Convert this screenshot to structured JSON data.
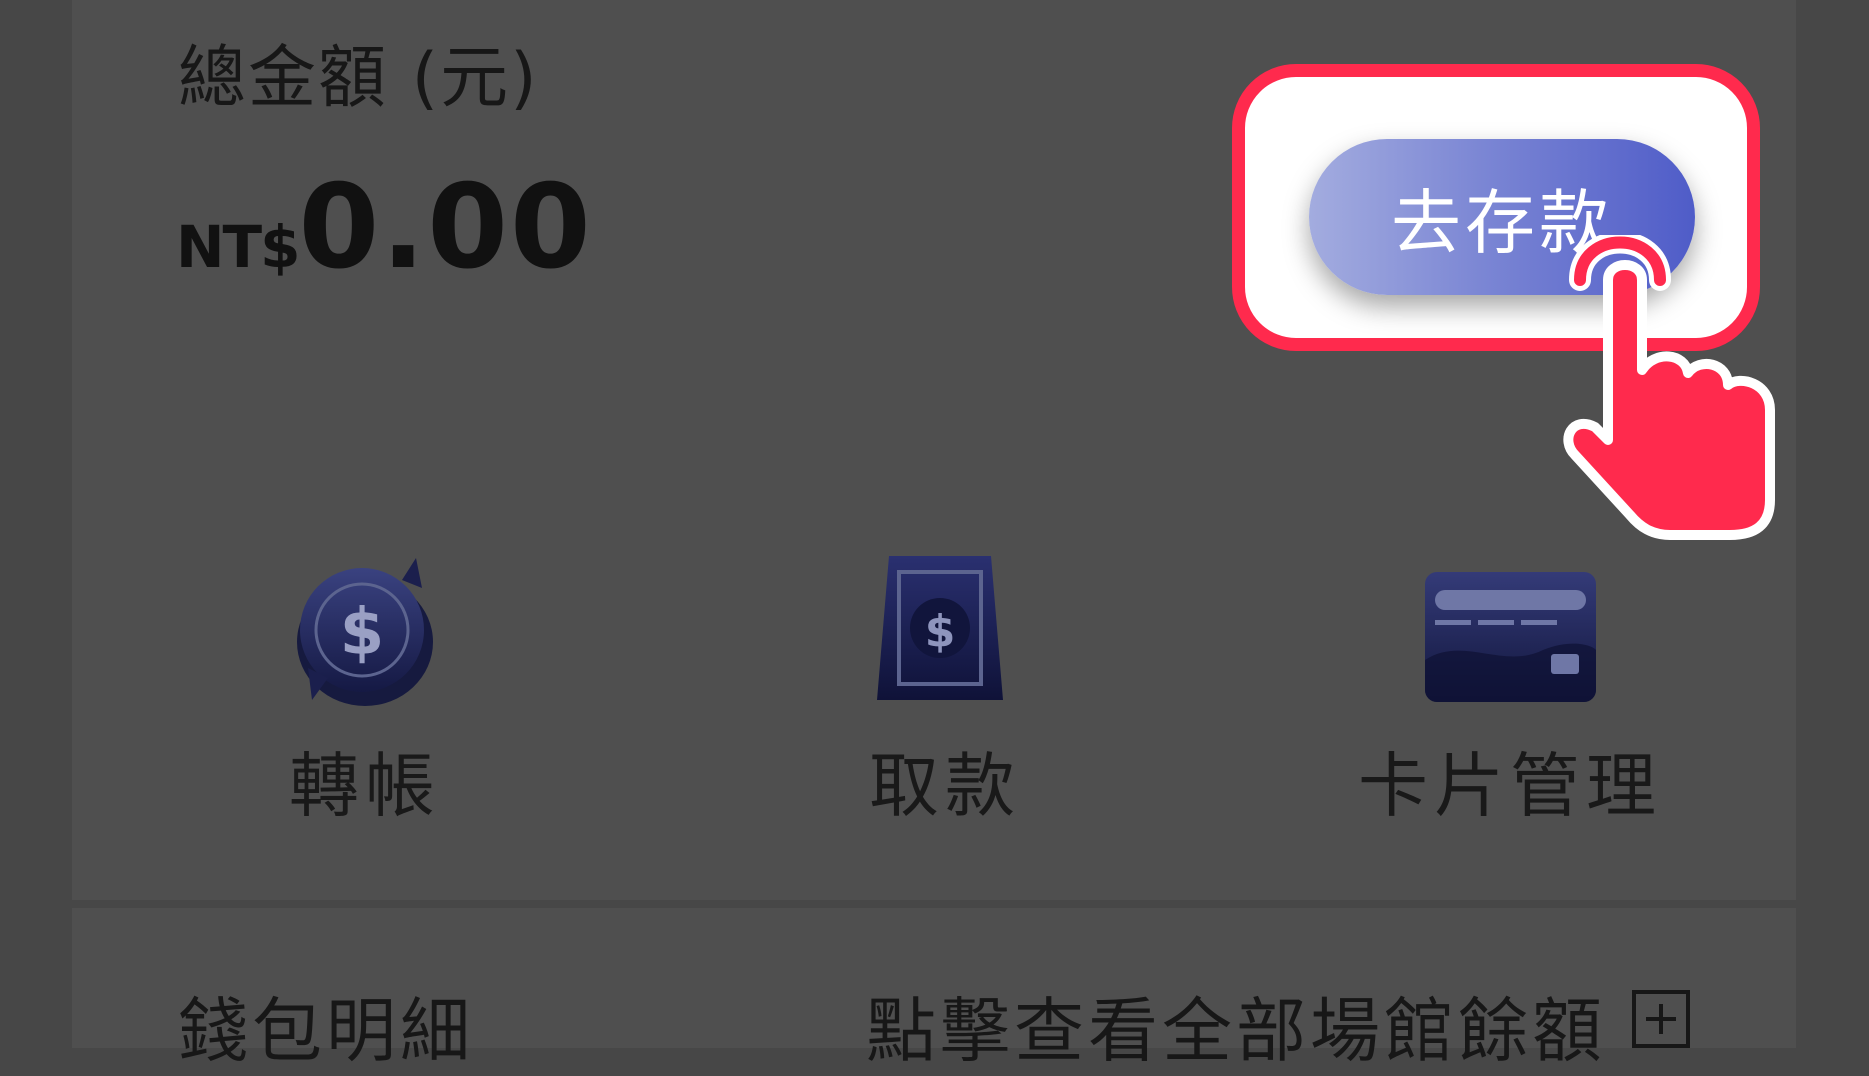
{
  "wallet": {
    "total_label": "總金額 (元)",
    "currency": "NT$",
    "amount": "0.00",
    "deposit_button": "去存款",
    "actions": [
      {
        "label": "轉帳",
        "icon": "transfer-icon"
      },
      {
        "label": "取款",
        "icon": "withdraw-icon"
      },
      {
        "label": "卡片管理",
        "icon": "card-icon"
      }
    ]
  },
  "details": {
    "title": "錢包明細",
    "link": "點擊查看全部場館餘額",
    "expand_icon": "plus-box-icon"
  },
  "colors": {
    "highlight": "#ff2a4d",
    "button_gradient_start": "#a3acdf",
    "button_gradient_end": "#4f5cc8",
    "icon_navy": "#1b1f4d"
  }
}
